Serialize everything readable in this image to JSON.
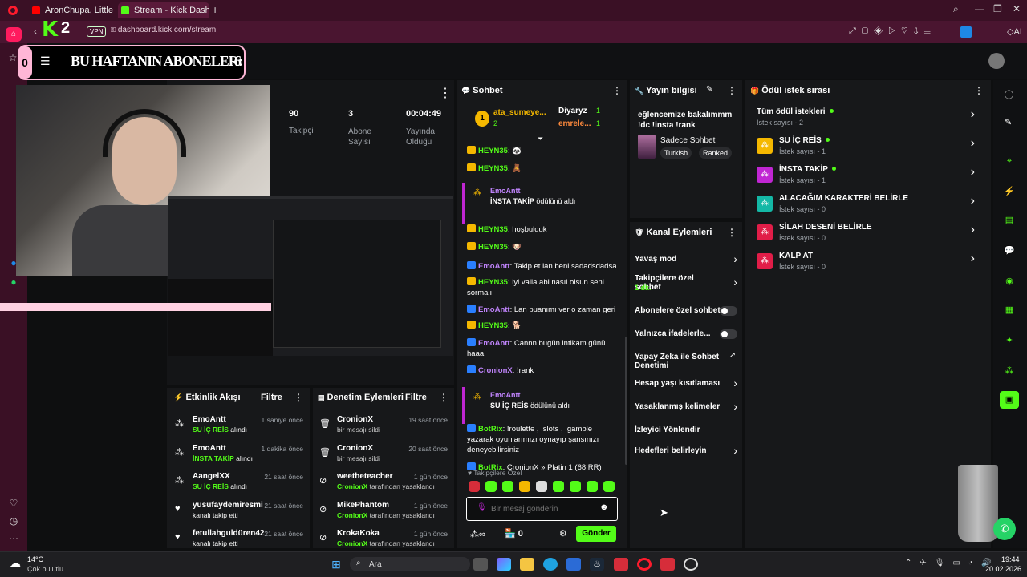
{
  "browser": {
    "tabs": [
      {
        "label": "AronChupa, Little Sis N..."
      },
      {
        "label": "Stream - Kick Dashboard"
      }
    ],
    "new_tab": "+",
    "url": "dashboard.kick.com/stream",
    "vpn": "VPN",
    "ai_label": "AI"
  },
  "overlay": {
    "banner_title": "BU HAFTANIN ABONELER:",
    "banner_count": "6",
    "left_count": "0",
    "kick_logo": "K",
    "kick_num": "2"
  },
  "stats": [
    {
      "value": "90",
      "label": "Takipçi"
    },
    {
      "value": "3",
      "label": "Abone Sayısı"
    },
    {
      "value": "00:04:49",
      "label": "Yayında Olduğu"
    }
  ],
  "activity": {
    "title": "Etkinlik Akışı",
    "filter": "Filtre",
    "items": [
      {
        "user": "EmoAntt",
        "reward": "SU İÇ REİS",
        "suffix": " alındı",
        "time": "1 saniye önce"
      },
      {
        "user": "EmoAntt",
        "reward": "İNSTA TAKİP",
        "suffix": " alındı",
        "time": "1 dakika önce"
      },
      {
        "user": "AangelXX",
        "reward": "SU İÇ REİS",
        "suffix": " alındı",
        "time": "21 saat önce"
      },
      {
        "user": "yusufaydemiresmi",
        "reward": "",
        "suffix": "kanalı takip etti",
        "time": "21 saat önce"
      },
      {
        "user": "fetullahguldüren42",
        "reward": "",
        "suffix": "kanalı takip etti",
        "time": "21 saat önce"
      }
    ]
  },
  "moderation": {
    "title": "Denetim Eylemleri",
    "filter": "Filtre",
    "items": [
      {
        "user": "CronionX",
        "desc": "bir mesajı sildi",
        "mod": "",
        "time": "19 saat önce"
      },
      {
        "user": "CronionX",
        "desc": "bir mesajı sildi",
        "mod": "",
        "time": "20 saat önce"
      },
      {
        "user": "weetheteacher",
        "desc": " tarafından yasaklandı",
        "mod": "CronionX",
        "time": "1 gün önce"
      },
      {
        "user": "MikePhantom",
        "desc": " tarafından yasaklandı",
        "mod": "CronionX",
        "time": "1 gün önce"
      },
      {
        "user": "KrokaKoka",
        "desc": " tarafından yasaklandı",
        "mod": "CronionX",
        "time": "1 gün önce"
      }
    ]
  },
  "chat": {
    "title": "Sohbet",
    "top_gifters": [
      {
        "rank": "1",
        "name": "ata_sumeye...",
        "count": "2"
      },
      {
        "name": "Diyaryz",
        "count": "1"
      },
      {
        "name": "emrele...",
        "count": "1"
      }
    ],
    "messages": [
      {
        "user": "HEYN35",
        "text": "🐼"
      },
      {
        "user": "HEYN35",
        "text": "🧸"
      },
      {
        "system_user": "EmoAntt",
        "system_reward": "İNSTA TAKİP",
        "system_text": " ödülünü aldı"
      },
      {
        "user": "HEYN35",
        "text": "hoşbulduk"
      },
      {
        "user": "HEYN35",
        "text": "🐶"
      },
      {
        "user": "EmoAntt",
        "text": "Takip et lan beni sadadsdadsa"
      },
      {
        "user": "HEYN35",
        "text": "iyi valla abi nasıl olsun seni sormalı"
      },
      {
        "user": "EmoAntt",
        "text": "Lan puanımı ver o zaman geri"
      },
      {
        "user": "HEYN35",
        "text": "🐕"
      },
      {
        "user": "EmoAntt",
        "text": "Cannn bugün intikam günü haaa"
      },
      {
        "user": "CronionX",
        "text": "!rank"
      },
      {
        "system_user": "EmoAntt",
        "system_reward": "SU İÇ REİS",
        "system_text": " ödülünü aldı"
      },
      {
        "user": "BotRix",
        "text": "!roulette , !slots , !gamble yazarak oyunlarımızı oynayıp şansınızı deneyebilirsiniz"
      },
      {
        "user": "BotRix",
        "text": "CronionX » Platin 1 (68 RR)"
      }
    ],
    "followers_only": "Takipçilere Özel",
    "input_placeholder": "Bir mesaj gönderin",
    "points": "∞",
    "store_count": "0",
    "send": "Gönder"
  },
  "stream_info": {
    "title": "Yayın bilgisi",
    "stream_title": "eğlencemize bakalımmm !dc !insta !rank",
    "category": "Sadece Sohbet",
    "tags": [
      "Turkish",
      "Ranked"
    ]
  },
  "channel_actions": {
    "title": "Kanal Eylemleri",
    "items": [
      {
        "label": "Yavaş mod",
        "sub": "",
        "control": "chevron"
      },
      {
        "label": "Takipçilere özel sohbet",
        "sub": "1 dk.",
        "control": "chevron"
      },
      {
        "label": "Abonelere özel sohbet",
        "sub": "",
        "control": "toggle"
      },
      {
        "label": "Yalnızca ifadelerle...",
        "sub": "",
        "control": "toggle"
      },
      {
        "label": "Yapay Zeka ile Sohbet Denetimi",
        "sub": "",
        "control": "external"
      },
      {
        "label": "Hesap yaşı kısıtlaması",
        "sub": "",
        "control": "chevron"
      },
      {
        "label": "Yasaklanmış kelimeler",
        "sub": "",
        "control": "chevron"
      },
      {
        "label": "İzleyici Yönlendir",
        "sub": "",
        "control": "none"
      },
      {
        "label": "Hedefleri belirleyin",
        "sub": "",
        "control": "chevron"
      }
    ]
  },
  "rewards": {
    "title": "Ödül istek sırası",
    "items": [
      {
        "name": "Tüm ödül istekleri",
        "sub": "İstek sayısı - 2",
        "dot": true,
        "color": ""
      },
      {
        "name": "SU İÇ REİS",
        "sub": "İstek sayısı - 1",
        "dot": true,
        "color": "#f5b800"
      },
      {
        "name": "İNSTA TAKİP",
        "sub": "İstek sayısı - 1",
        "dot": true,
        "color": "#c026d3"
      },
      {
        "name": "ALACAĞIM KARAKTERİ BELİRLE",
        "sub": "İstek sayısı - 0",
        "dot": false,
        "color": "#14b8a6"
      },
      {
        "name": "SİLAH DESENİ BELİRLE",
        "sub": "İstek sayısı - 0",
        "dot": false,
        "color": "#e11d48"
      },
      {
        "name": "KALP AT",
        "sub": "İstek sayısı - 0",
        "dot": false,
        "color": "#e11d48"
      }
    ]
  },
  "taskbar": {
    "weather_temp": "14°C",
    "weather_desc": "Çok bulutlu",
    "search": "Ara",
    "time": "19:44",
    "date": "20.02.2026"
  }
}
